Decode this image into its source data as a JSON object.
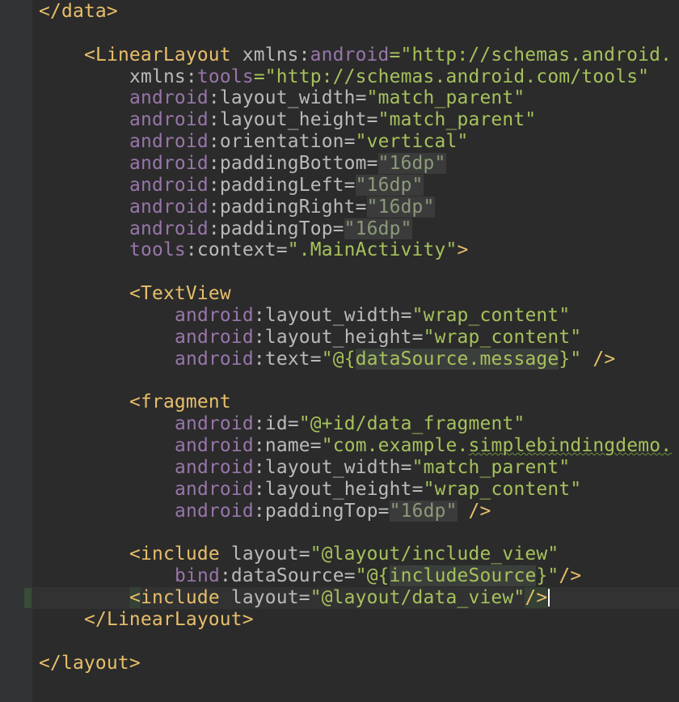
{
  "editor": {
    "lines": [
      {
        "indent": 0,
        "parts": [
          {
            "t": "</data>",
            "c": "tag"
          }
        ]
      },
      {
        "indent": 0,
        "parts": []
      },
      {
        "indent": 1,
        "parts": [
          {
            "t": "<LinearLayout ",
            "c": "tag"
          },
          {
            "t": "xmlns:",
            "c": "attr"
          },
          {
            "t": "android",
            "c": "ns"
          },
          {
            "t": "=\"http://schemas.android.",
            "c": "strb"
          }
        ]
      },
      {
        "indent": 2,
        "parts": [
          {
            "t": "xmlns:",
            "c": "attr"
          },
          {
            "t": "tools",
            "c": "ns"
          },
          {
            "t": "=\"http://schemas.android.com/tools\"",
            "c": "strb"
          }
        ]
      },
      {
        "indent": 2,
        "parts": [
          {
            "t": "android",
            "c": "ns"
          },
          {
            "t": ":layout_width=",
            "c": "attr"
          },
          {
            "t": "\"match_parent\"",
            "c": "strb"
          }
        ]
      },
      {
        "indent": 2,
        "parts": [
          {
            "t": "android",
            "c": "ns"
          },
          {
            "t": ":layout_height=",
            "c": "attr"
          },
          {
            "t": "\"match_parent\"",
            "c": "strb"
          }
        ]
      },
      {
        "indent": 2,
        "parts": [
          {
            "t": "android",
            "c": "ns"
          },
          {
            "t": ":orientation=",
            "c": "attr"
          },
          {
            "t": "\"vertical\"",
            "c": "strb"
          }
        ]
      },
      {
        "indent": 2,
        "parts": [
          {
            "t": "android",
            "c": "ns"
          },
          {
            "t": ":paddingBottom=",
            "c": "attr"
          },
          {
            "t": "\"16dp\"",
            "c": "hl"
          }
        ]
      },
      {
        "indent": 2,
        "parts": [
          {
            "t": "android",
            "c": "ns"
          },
          {
            "t": ":paddingLeft=",
            "c": "attr"
          },
          {
            "t": "\"16dp\"",
            "c": "hl"
          }
        ]
      },
      {
        "indent": 2,
        "parts": [
          {
            "t": "android",
            "c": "ns"
          },
          {
            "t": ":paddingRight=",
            "c": "attr"
          },
          {
            "t": "\"16dp\"",
            "c": "hl"
          }
        ]
      },
      {
        "indent": 2,
        "parts": [
          {
            "t": "android",
            "c": "ns"
          },
          {
            "t": ":paddingTop=",
            "c": "attr"
          },
          {
            "t": "\"16dp\"",
            "c": "hl"
          }
        ]
      },
      {
        "indent": 2,
        "parts": [
          {
            "t": "tools",
            "c": "ns"
          },
          {
            "t": ":context=",
            "c": "attr"
          },
          {
            "t": "\".MainActivity\"",
            "c": "strb"
          },
          {
            "t": ">",
            "c": "tag"
          }
        ]
      },
      {
        "indent": 0,
        "parts": []
      },
      {
        "indent": 2,
        "parts": [
          {
            "t": "<TextView",
            "c": "tag"
          }
        ]
      },
      {
        "indent": 3,
        "parts": [
          {
            "t": "android",
            "c": "ns"
          },
          {
            "t": ":layout_width=",
            "c": "attr"
          },
          {
            "t": "\"wrap_content\"",
            "c": "strb"
          }
        ]
      },
      {
        "indent": 3,
        "parts": [
          {
            "t": "android",
            "c": "ns"
          },
          {
            "t": ":layout_height=",
            "c": "attr"
          },
          {
            "t": "\"wrap_content\"",
            "c": "strb"
          }
        ]
      },
      {
        "indent": 3,
        "parts": [
          {
            "t": "android",
            "c": "ns"
          },
          {
            "t": ":text=",
            "c": "attr"
          },
          {
            "t": "\"@{",
            "c": "strb"
          },
          {
            "t": "dataSource.message",
            "c": "expr"
          },
          {
            "t": "}\"",
            "c": "strb"
          },
          {
            "t": " />",
            "c": "tag"
          }
        ]
      },
      {
        "indent": 0,
        "parts": []
      },
      {
        "indent": 2,
        "parts": [
          {
            "t": "<fragment",
            "c": "tag"
          }
        ]
      },
      {
        "indent": 3,
        "parts": [
          {
            "t": "android",
            "c": "ns"
          },
          {
            "t": ":id=",
            "c": "attr"
          },
          {
            "t": "\"@+id/data_fragment\"",
            "c": "strb"
          }
        ]
      },
      {
        "indent": 3,
        "parts": [
          {
            "t": "android",
            "c": "ns"
          },
          {
            "t": ":name=",
            "c": "attr"
          },
          {
            "t": "\"com.example.",
            "c": "strb"
          },
          {
            "t": "simplebindingdemo.",
            "c": "strb squig"
          }
        ]
      },
      {
        "indent": 3,
        "parts": [
          {
            "t": "android",
            "c": "ns"
          },
          {
            "t": ":layout_width=",
            "c": "attr"
          },
          {
            "t": "\"match_parent\"",
            "c": "strb"
          }
        ]
      },
      {
        "indent": 3,
        "parts": [
          {
            "t": "android",
            "c": "ns"
          },
          {
            "t": ":layout_height=",
            "c": "attr"
          },
          {
            "t": "\"wrap_content\"",
            "c": "strb"
          }
        ]
      },
      {
        "indent": 3,
        "parts": [
          {
            "t": "android",
            "c": "ns"
          },
          {
            "t": ":paddingTop=",
            "c": "attr"
          },
          {
            "t": "\"16dp\"",
            "c": "hl"
          },
          {
            "t": " />",
            "c": "tag"
          }
        ]
      },
      {
        "indent": 0,
        "parts": []
      },
      {
        "indent": 2,
        "parts": [
          {
            "t": "<include ",
            "c": "tag"
          },
          {
            "t": "layout=",
            "c": "attr"
          },
          {
            "t": "\"@layout/include_view\"",
            "c": "strb"
          }
        ]
      },
      {
        "indent": 3,
        "parts": [
          {
            "t": "bind",
            "c": "ns"
          },
          {
            "t": ":dataSource=",
            "c": "attr"
          },
          {
            "t": "\"@{",
            "c": "strb"
          },
          {
            "t": "includeSource",
            "c": "expr"
          },
          {
            "t": "}\"",
            "c": "strb"
          },
          {
            "t": "/>",
            "c": "tag"
          }
        ]
      },
      {
        "indent": 2,
        "parts": [
          {
            "t": "<",
            "c": "tag hlb"
          },
          {
            "t": "include ",
            "c": "tag"
          },
          {
            "t": "layout=",
            "c": "attr"
          },
          {
            "t": "\"@layout/data_view\"",
            "c": "strb"
          },
          {
            "t": "/>",
            "c": "tag hlb"
          }
        ],
        "caret": true
      },
      {
        "indent": 1,
        "parts": [
          {
            "t": "</LinearLayout>",
            "c": "tag"
          }
        ]
      },
      {
        "indent": 0,
        "parts": []
      },
      {
        "indent": 0,
        "parts": [
          {
            "t": "</layout>",
            "c": "tag"
          }
        ]
      }
    ]
  }
}
